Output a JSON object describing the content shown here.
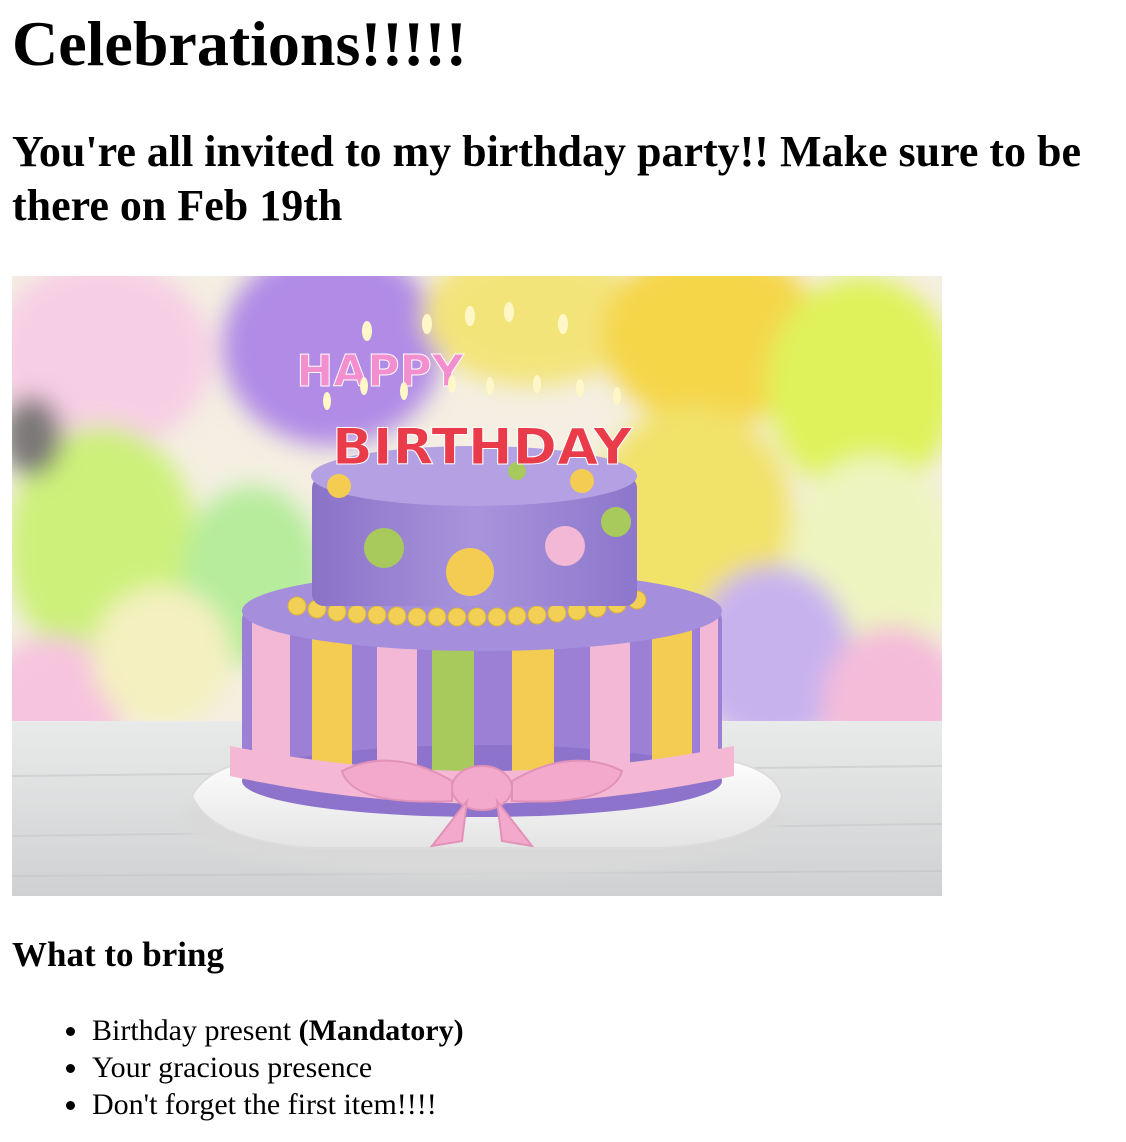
{
  "page": {
    "title": "Celebrations!!!!!",
    "invite": "You're all invited to my birthday party!! Make sure to be there on Feb 19th"
  },
  "image": {
    "cake_letters_top": "HAPPY",
    "cake_letters_bottom": "BIRTHDAY",
    "balloon_colors": [
      "#b88ee8",
      "#d2f26a",
      "#f3a8d8",
      "#f7d445",
      "#9de0b2"
    ],
    "cake_colors": {
      "purple": "#9e86d4",
      "pink": "#f2b6d6",
      "yellow": "#f4cc52",
      "green": "#a8c95c"
    }
  },
  "bring": {
    "heading": "What to bring",
    "items": [
      {
        "text": "Birthday present ",
        "open": "(",
        "bold": "Mandatory",
        "close": ")"
      },
      {
        "text": "Your gracious presence"
      },
      {
        "text": "Don't forget the first item!!!!"
      }
    ]
  }
}
